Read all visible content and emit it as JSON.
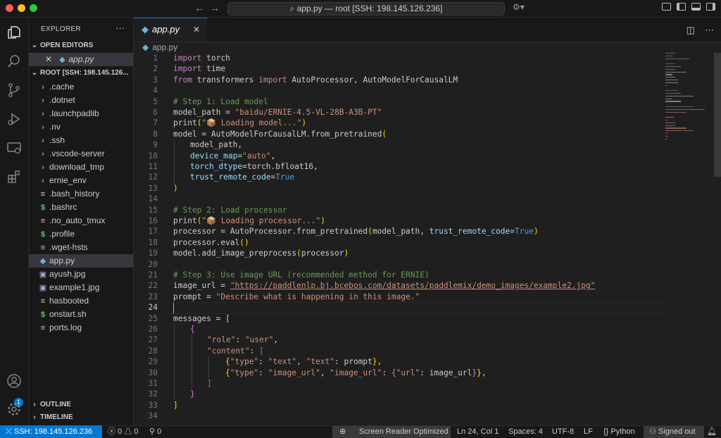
{
  "window": {
    "title": "app.py — root [SSH: 198.145.126.236]",
    "search_prefix": "⌕"
  },
  "explorer": {
    "header": "EXPLORER",
    "more": "···",
    "open_editors_label": "OPEN EDITORS",
    "open_editor_file": "app.py",
    "root_label": "ROOT [SSH: 198.145.126...",
    "outline_label": "OUTLINE",
    "timeline_label": "TIMELINE",
    "items": [
      {
        "label": ".cache",
        "kind": "folder"
      },
      {
        "label": ".dotnet",
        "kind": "folder"
      },
      {
        "label": ".launchpadlib",
        "kind": "folder"
      },
      {
        "label": ".nv",
        "kind": "folder"
      },
      {
        "label": ".ssh",
        "kind": "folder"
      },
      {
        "label": ".vscode-server",
        "kind": "folder"
      },
      {
        "label": "download_tmp",
        "kind": "folder"
      },
      {
        "label": "ernie_env",
        "kind": "folder"
      },
      {
        "label": ".bash_history",
        "kind": "file"
      },
      {
        "label": ".bashrc",
        "kind": "shell"
      },
      {
        "label": ".no_auto_tmux",
        "kind": "file"
      },
      {
        "label": ".profile",
        "kind": "shell"
      },
      {
        "label": ".wget-hsts",
        "kind": "file"
      },
      {
        "label": "app.py",
        "kind": "python"
      },
      {
        "label": "ayush.jpg",
        "kind": "image"
      },
      {
        "label": "example1.jpg",
        "kind": "image"
      },
      {
        "label": "hasbooted",
        "kind": "file"
      },
      {
        "label": "onstart.sh",
        "kind": "shell"
      },
      {
        "label": "ports.log",
        "kind": "file"
      }
    ]
  },
  "editor": {
    "tab_label": "app.py",
    "breadcrumb": "app.py",
    "active_line": "24",
    "line_numbers": [
      "1",
      "2",
      "3",
      "4",
      "5",
      "6",
      "7",
      "8",
      "9",
      "10",
      "11",
      "12",
      "13",
      "14",
      "15",
      "16",
      "17",
      "18",
      "19",
      "20",
      "21",
      "22",
      "23",
      "24",
      "25",
      "26",
      "27",
      "28",
      "29",
      "30",
      "31",
      "32",
      "33",
      "34"
    ],
    "t": {
      "import": "import",
      "from": "from",
      "l1": " torch",
      "l2": " time",
      "l3a": " transformers ",
      "l3b": " AutoProcessor, AutoModelForCausalLM",
      "l5": "# Step 1: Load model",
      "l6a": "model_path = ",
      "l6b": "\"baidu/ERNIE-4.5-VL-28B-A3B-PT\"",
      "print": "print",
      "l7s": "\"📦 Loading model...\"",
      "l8a": "model = AutoModelForCausalLM.from_pretrained",
      "l9": "model_path,",
      "l10a": "device_map",
      "l10b": "\"auto\"",
      "l11a": "torch_dtype",
      "l11b": "=torch.bfloat16,",
      "l12a": "trust_remote_code",
      "true": "True",
      "eq": "=",
      "comma": ",",
      "l15": "# Step 2: Load processor",
      "l16s": "\"📦 Loading processor...\"",
      "l17a": "processor = AutoProcessor.from_pretrained",
      "l17b": "model_path, ",
      "l18": "processor.eval",
      "l19a": "model.add_image_preprocess",
      "l19b": "processor",
      "l21": "# Step 3: Use image URL (recommended method for ERNIE)",
      "l22a": "image_url = ",
      "l22b": "\"https://paddlenlp.bj.bcebos.com/datasets/paddlemix/demo_images/example2.jpg\"",
      "l23a": "prompt = ",
      "l23b": "\"Describe what is happening in this image.\"",
      "l25a": "messages = ",
      "l27a": "\"role\"",
      "l27b": "\"user\"",
      "l28a": "\"content\"",
      "colon": ": ",
      "k_type": "\"type\"",
      "v_text": "\"text\"",
      "k_text": "\"text\"",
      "l29v": "prompt",
      "v_image_url": "\"image_url\"",
      "k_image_url": "\"image_url\"",
      "k_url": "\"url\"",
      "l30v": "image_url",
      "lp": "(",
      "rp": ")",
      "lb": "[",
      "rb": "]",
      "lc": "{",
      "rc": "}",
      "rcc": "},",
      "rpp": "()"
    }
  },
  "status": {
    "remote": "SSH: 198.145.126.236",
    "errors": "0",
    "warnings": "0",
    "ports": "0",
    "screen_reader": "Screen Reader Optimized",
    "position": "Ln 24, Col 1",
    "spaces": "Spaces: 4",
    "encoding": "UTF-8",
    "eol": "LF",
    "language": "Python",
    "account": "Signed out",
    "account_badge": "1"
  },
  "colors": {
    "accent": "#0078d4",
    "keyword": "#c586c0",
    "string": "#ce9178",
    "comment": "#6a9955",
    "param": "#9cdcfe"
  }
}
